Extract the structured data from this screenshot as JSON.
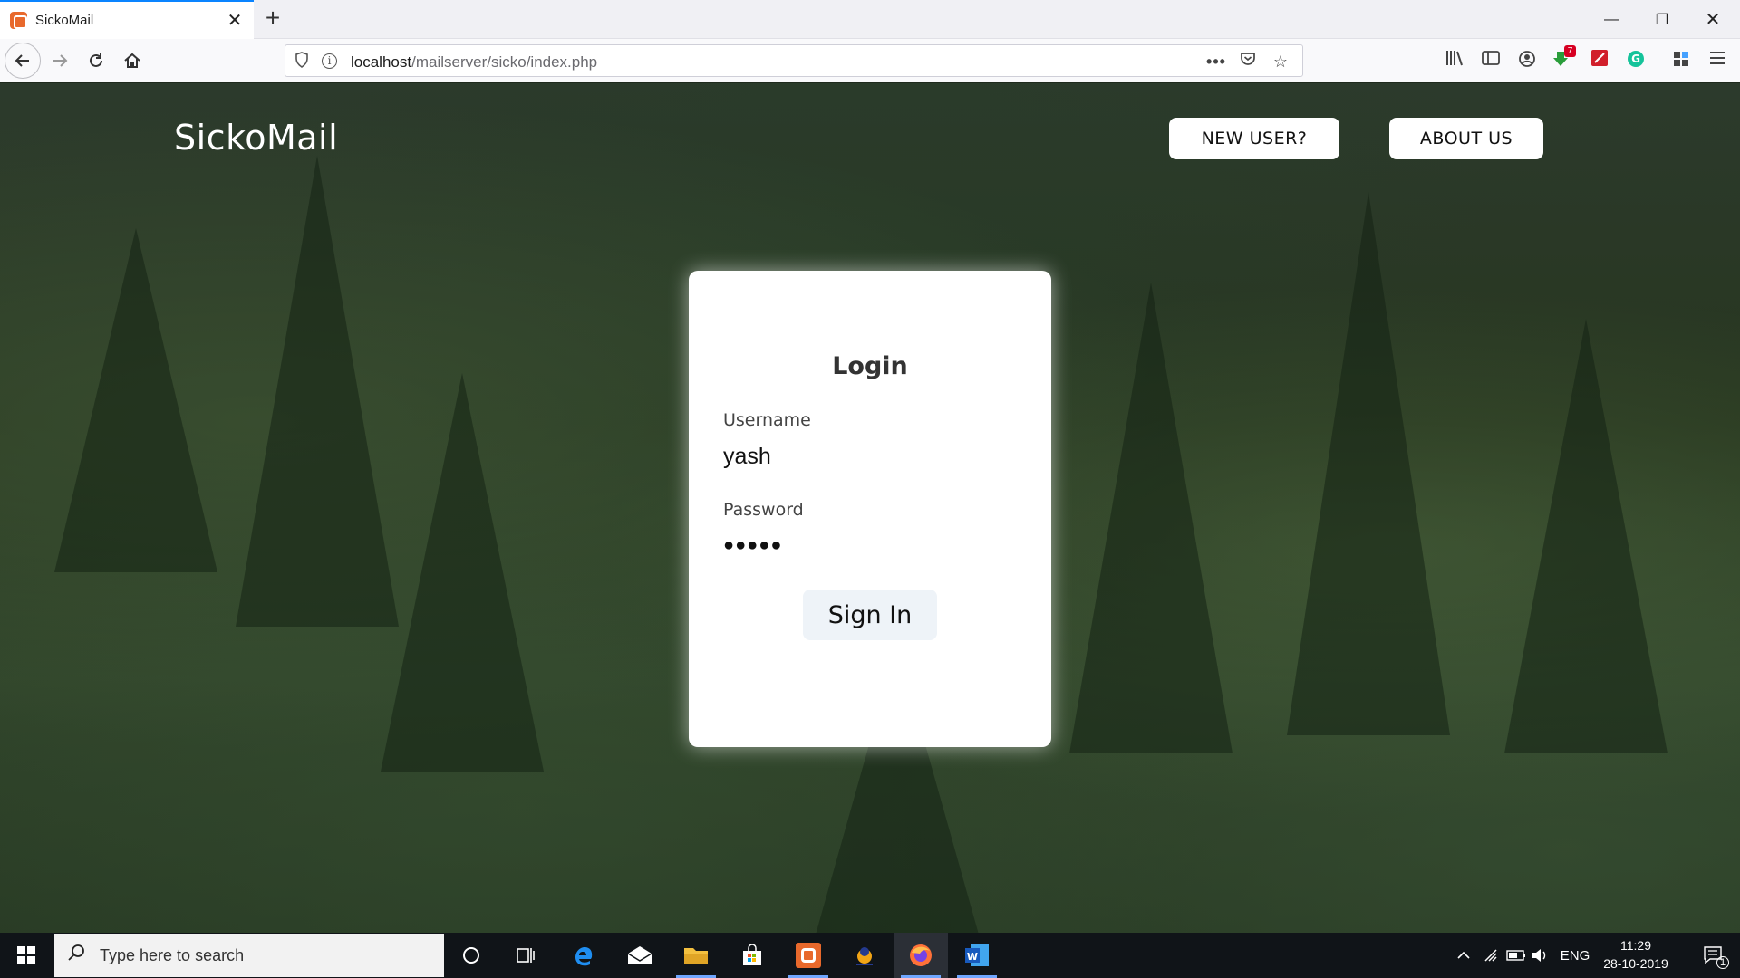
{
  "browser": {
    "tab_title": "SickoMail",
    "url_host": "localhost",
    "url_path": "/mailserver/sicko/index.php",
    "badge_count": "7"
  },
  "site": {
    "brand": "SickoMail",
    "new_user_label": "NEW USER?",
    "about_label": "ABOUT US"
  },
  "login": {
    "heading": "Login",
    "username_label": "Username",
    "username_value": "yash",
    "password_label": "Password",
    "password_value": "●●●●●",
    "submit_label": "Sign In"
  },
  "taskbar": {
    "search_placeholder": "Type here to search",
    "language": "ENG",
    "time": "11:29",
    "date": "28-10-2019",
    "notification_count": "1"
  },
  "colors": {
    "tab_accent": "#0a84ff",
    "card_bg": "#ffffff",
    "taskbar_bg": "#101418"
  }
}
